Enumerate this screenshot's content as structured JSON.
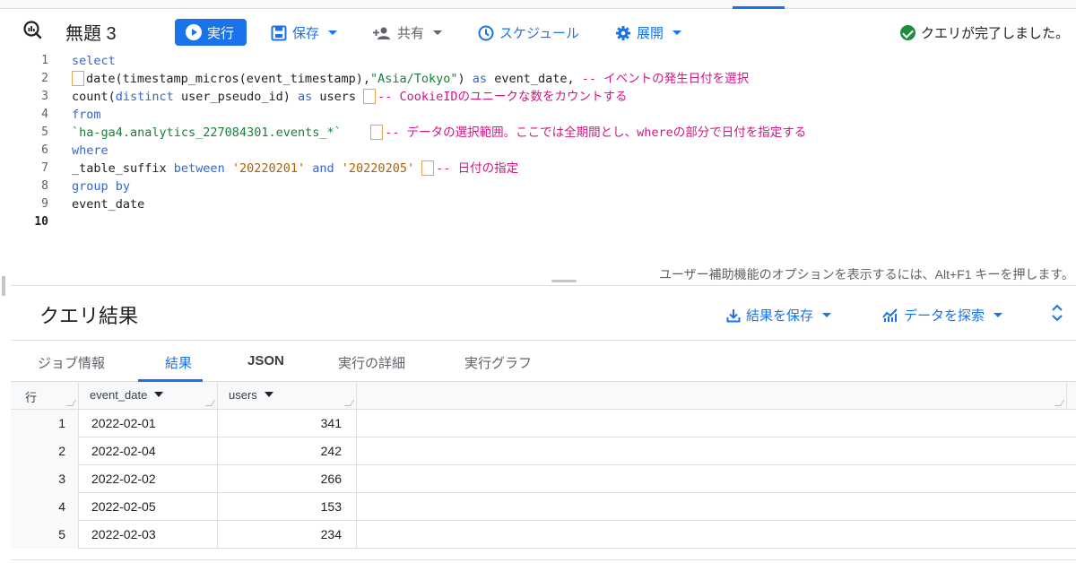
{
  "toolbar": {
    "title": "無題 3",
    "run_label": "実行",
    "save_label": "保存",
    "share_label": "共有",
    "schedule_label": "スケジュール",
    "deploy_label": "展開",
    "status_text": "クエリが完了しました。"
  },
  "editor": {
    "line_numbers": [
      "1",
      "2",
      "3",
      "4",
      "5",
      "6",
      "7",
      "8",
      "9",
      "10"
    ],
    "lines": {
      "l1": "select",
      "l2_code": "date(timestamp_micros(event_timestamp),",
      "l2_str": "\"Asia/Tokyo\"",
      "l2_rest": ") ",
      "l2_as": "as",
      "l2_alias": " event_date, ",
      "l2_comment": "-- イベントの発生日付を選択",
      "l3_count": "count(",
      "l3_distinct": "distinct",
      "l3_col": " user_pseudo_id) ",
      "l3_as": "as",
      "l3_alias": " users ",
      "l3_comment": "-- CookieIDのユニークな数をカウントする",
      "l4": "from",
      "l5_table": "`ha-ga4.analytics_227084301.events_*`",
      "l5_comment": "-- データの選択範囲。ここでは全期間とし、whereの部分で日付を指定する",
      "l6": "where",
      "l7_col": "_table_suffix ",
      "l7_between": "between",
      "l7_v1": "'20220201'",
      "l7_and": "and",
      "l7_v2": "'20220205'",
      "l7_comment": "-- 日付の指定",
      "l8": "group by",
      "l9": "event_date"
    },
    "accessibility_hint": "ユーザー補助機能のオプションを表示するには、Alt+F1 キーを押します。"
  },
  "results": {
    "title": "クエリ結果",
    "save_results_label": "結果を保存",
    "explore_data_label": "データを探索",
    "tabs": [
      "ジョブ情報",
      "結果",
      "JSON",
      "実行の詳細",
      "実行グラフ"
    ],
    "active_tab": "結果",
    "columns": [
      "行",
      "event_date",
      "users"
    ],
    "rows": [
      {
        "n": "1",
        "event_date": "2022-02-01",
        "users": "341"
      },
      {
        "n": "2",
        "event_date": "2022-02-04",
        "users": "242"
      },
      {
        "n": "3",
        "event_date": "2022-02-02",
        "users": "266"
      },
      {
        "n": "4",
        "event_date": "2022-02-05",
        "users": "153"
      },
      {
        "n": "5",
        "event_date": "2022-02-03",
        "users": "234"
      }
    ]
  },
  "colors": {
    "accent": "#1a73e8",
    "keyword": "#3367d6",
    "comment": "#d01884",
    "string": "#188038",
    "success": "#1e8e3e"
  },
  "icons": [
    "query-icon",
    "play-icon",
    "save-icon",
    "person-add-icon",
    "clock-icon",
    "gear-icon",
    "check-circle-icon",
    "download-icon",
    "chart-icon",
    "expand-icon"
  ]
}
